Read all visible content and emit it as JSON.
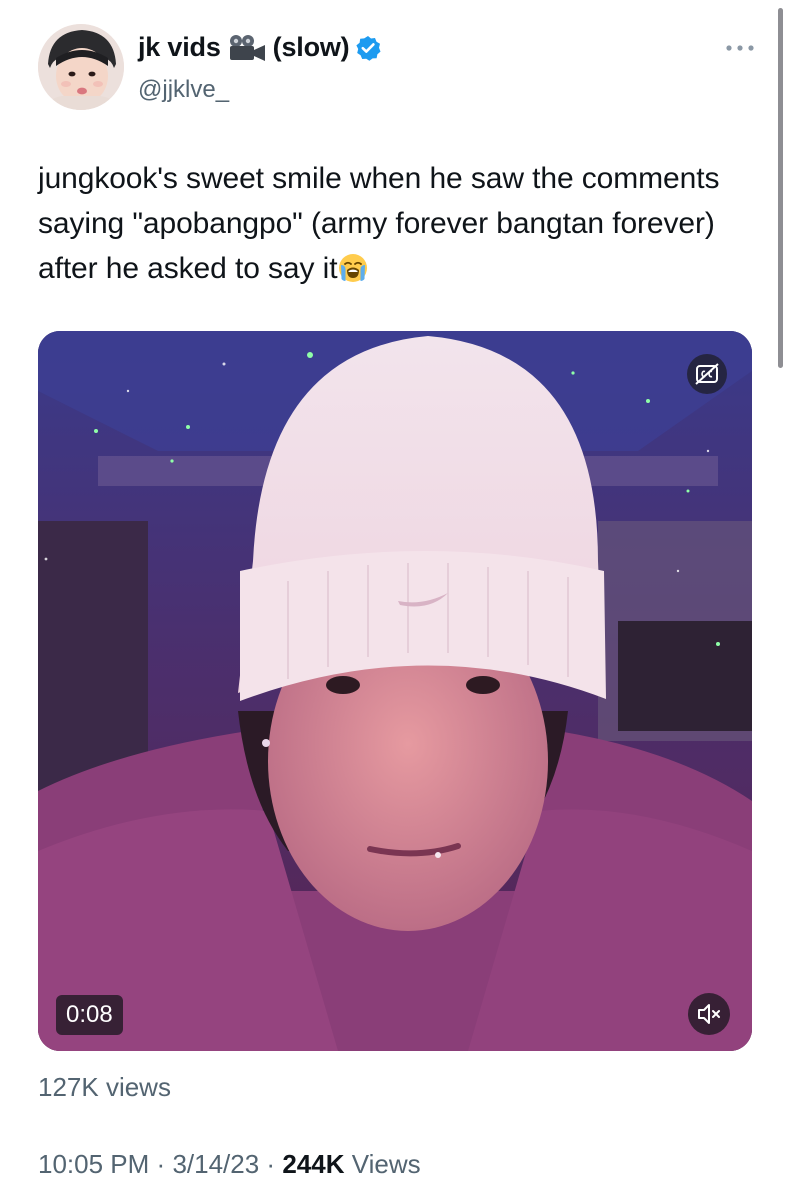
{
  "author": {
    "display_name": "jk vids",
    "name_suffix": "(slow)",
    "handle": "@jjklve_",
    "name_icon": "movie-camera-icon",
    "verified_icon": "verified-badge-icon",
    "verified_color": "#1d9bf0"
  },
  "tweet": {
    "text": "jungkook's sweet smile when he saw the comments saying \"apobangpo\" (army forever bangtan forever) after he asked to say it",
    "trailing_emoji": "loudly-crying-face-emoji"
  },
  "media": {
    "type": "video",
    "elapsed": "0:08",
    "captions_icon": "closed-captions-off-icon",
    "mute_icon": "speaker-muted-icon",
    "views_label": "127K views"
  },
  "meta": {
    "time": "10:05 PM",
    "separator": "·",
    "date": "3/14/23",
    "view_count": "244K",
    "views_word": "Views"
  },
  "colors": {
    "text_primary": "#0f1419",
    "text_secondary": "#536471"
  }
}
